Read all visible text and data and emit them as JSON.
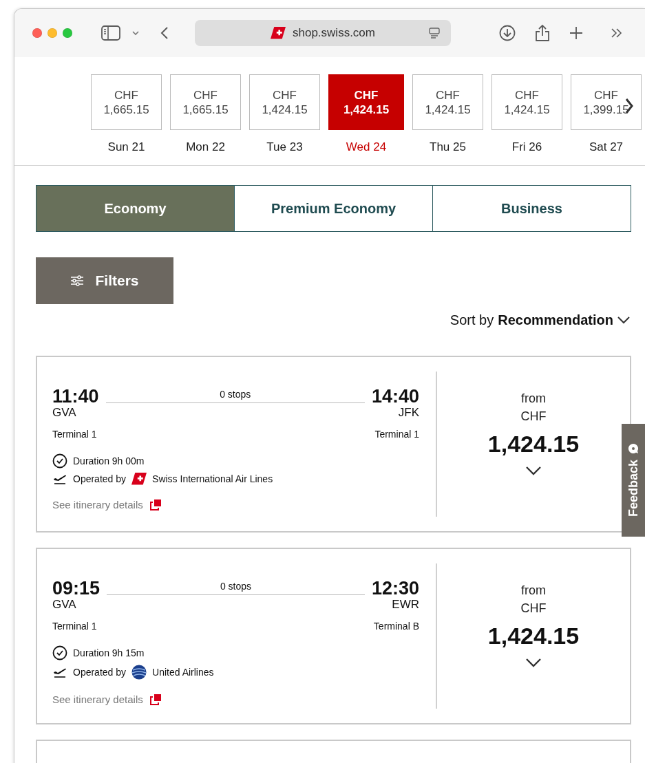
{
  "browser": {
    "url": "shop.swiss.com"
  },
  "dates": [
    {
      "currency": "CHF",
      "price": "1,665.15",
      "day": "Sun 21",
      "selected": false
    },
    {
      "currency": "CHF",
      "price": "1,665.15",
      "day": "Mon 22",
      "selected": false
    },
    {
      "currency": "CHF",
      "price": "1,424.15",
      "day": "Tue 23",
      "selected": false
    },
    {
      "currency": "CHF",
      "price": "1,424.15",
      "day": "Wed 24",
      "selected": true
    },
    {
      "currency": "CHF",
      "price": "1,424.15",
      "day": "Thu 25",
      "selected": false
    },
    {
      "currency": "CHF",
      "price": "1,424.15",
      "day": "Fri 26",
      "selected": false
    },
    {
      "currency": "CHF",
      "price": "1,399.15",
      "day": "Sat 27",
      "selected": false
    }
  ],
  "cabin_tabs": [
    {
      "label": "Economy",
      "selected": true
    },
    {
      "label": "Premium Economy",
      "selected": false
    },
    {
      "label": "Business",
      "selected": false
    }
  ],
  "filters_button": "Filters",
  "sort": {
    "label": "Sort by",
    "value": "Recommendation"
  },
  "flights": [
    {
      "departure_time": "11:40",
      "departure_airport": "GVA",
      "departure_terminal": "Terminal 1",
      "stops": "0 stops",
      "arrival_time": "14:40",
      "arrival_airport": "JFK",
      "arrival_terminal": "Terminal 1",
      "duration": "Duration 9h 00m",
      "operated_by": "Operated by",
      "kind": "swiss",
      "airline": "Swiss International Air Lines",
      "details_link": "See itinerary details",
      "price_prefix": "from",
      "currency": "CHF",
      "price": "1,424.15"
    },
    {
      "departure_time": "09:15",
      "departure_airport": "GVA",
      "departure_terminal": "Terminal 1",
      "stops": "0 stops",
      "arrival_time": "12:30",
      "arrival_airport": "EWR",
      "arrival_terminal": "Terminal B",
      "duration": "Duration 9h 15m",
      "operated_by": "Operated by",
      "kind": "united",
      "airline": "United Airlines",
      "details_link": "See itinerary details",
      "price_prefix": "from",
      "currency": "CHF",
      "price": "1,424.15"
    }
  ],
  "feedback": "Feedback"
}
